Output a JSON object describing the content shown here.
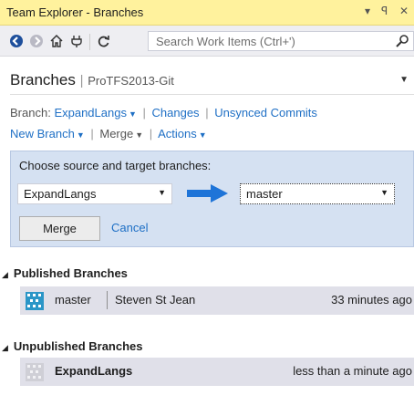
{
  "window": {
    "title": "Team Explorer - Branches",
    "dropdown_glyph": "▾",
    "pin_glyph": "ꟼ",
    "close_glyph": "✕"
  },
  "toolbar": {
    "icons": [
      "back-icon",
      "forward-icon",
      "home-icon",
      "connect-icon",
      "refresh-icon",
      "search-icon"
    ],
    "search_placeholder": "Search Work Items (Ctrl+')"
  },
  "header": {
    "title": "Branches",
    "separator": "|",
    "project": "ProTFS2013-Git"
  },
  "branch_line": {
    "label": "Branch:",
    "current": "ExpandLangs",
    "changes": "Changes",
    "unsynced": "Unsynced Commits"
  },
  "actions_line": {
    "new_branch": "New Branch",
    "merge": "Merge",
    "actions": "Actions"
  },
  "merge_panel": {
    "heading": "Choose source and target branches:",
    "source": "ExpandLangs",
    "target": "master",
    "merge_button": "Merge",
    "cancel_link": "Cancel",
    "arrow_color": "#1e74d8"
  },
  "published": {
    "title": "Published Branches",
    "items": [
      {
        "name": "master",
        "author": "Steven St Jean",
        "time": "33 minutes ago"
      }
    ]
  },
  "unpublished": {
    "title": "Unpublished Branches",
    "items": [
      {
        "name": "ExpandLangs",
        "time": "less than a minute ago"
      }
    ]
  },
  "colors": {
    "title_bar": "#fff29d",
    "link": "#1e6fc5",
    "panel": "#d5e1f2",
    "item_bg": "#e0e0e9"
  }
}
